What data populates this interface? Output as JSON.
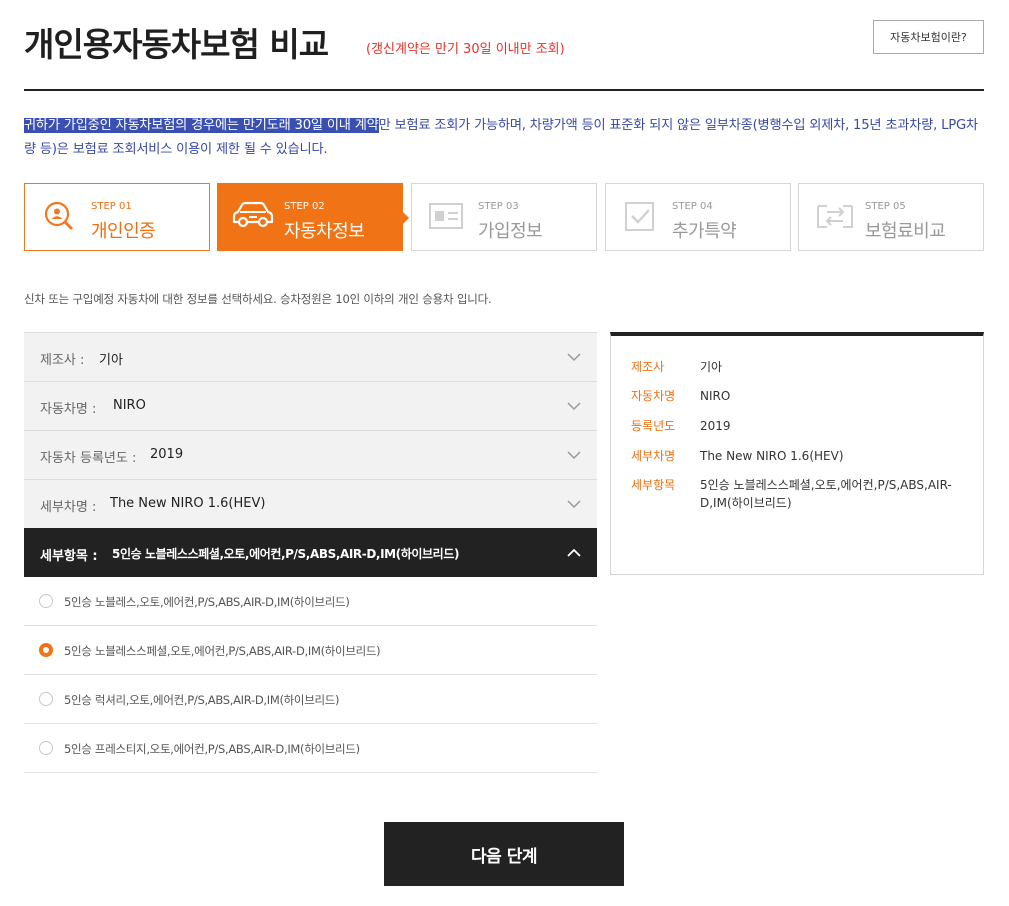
{
  "header": {
    "title": "개인용자동차보험 비교",
    "subtitle": "(갱신계약은 만기 30일 이내만 조회)",
    "help_button": "자동차보험이란?"
  },
  "notice": {
    "highlighted": "귀하가 가입중인 자동차보험의 경우에는 만기도래 30일 이내 계약",
    "rest": "만 보험료 조회가 가능하며, 차량가액 등이 표준화 되지 않은 일부차종(병행수입 외제차, 15년 초과차량, LPG차량 등)은 보험료 조회서비스 이용이 제한 될 수 있습니다."
  },
  "steps": [
    {
      "num": "STEP 01",
      "label": "개인인증",
      "icon": "person-search-icon",
      "state": "done"
    },
    {
      "num": "STEP 02",
      "label": "자동차정보",
      "icon": "car-icon",
      "state": "active"
    },
    {
      "num": "STEP 03",
      "label": "가입정보",
      "icon": "id-card-icon",
      "state": "todo"
    },
    {
      "num": "STEP 04",
      "label": "추가특약",
      "icon": "checkbox-icon",
      "state": "todo"
    },
    {
      "num": "STEP 05",
      "label": "보험료비교",
      "icon": "compare-icon",
      "state": "todo"
    }
  ],
  "guide": "신차 또는 구입예정 자동차에 대한 정보를 선택하세요. 승차정원은 10인 이하의 개인 승용차 입니다.",
  "accordion": [
    {
      "key": "제조사 : ",
      "value": "기아"
    },
    {
      "key": "자동차명 : ",
      "value": "NIRO"
    },
    {
      "key": "자동차 등록년도 : ",
      "value": "2019"
    },
    {
      "key": "세부차명 : ",
      "value": "The New NIRO 1.6(HEV)"
    },
    {
      "key": "세부항목 : ",
      "value": "5인승 노블레스스페셜,오토,에어컨,P/S,ABS,AIR-D,IM(하이브리드)"
    }
  ],
  "options": [
    {
      "label": "5인승 노블레스,오토,에어컨,P/S,ABS,AIR-D,IM(하이브리드)",
      "selected": false
    },
    {
      "label": "5인승 노블레스스페셜,오토,에어컨,P/S,ABS,AIR-D,IM(하이브리드)",
      "selected": true
    },
    {
      "label": "5인승 럭셔리,오토,에어컨,P/S,ABS,AIR-D,IM(하이브리드)",
      "selected": false
    },
    {
      "label": "5인승 프레스티지,오토,에어컨,P/S,ABS,AIR-D,IM(하이브리드)",
      "selected": false
    }
  ],
  "summary": [
    {
      "key": "제조사",
      "value": "기아"
    },
    {
      "key": "자동차명",
      "value": "NIRO"
    },
    {
      "key": "등록년도",
      "value": "2019"
    },
    {
      "key": "세부차명",
      "value": "The New NIRO 1.6(HEV)"
    },
    {
      "key": "세부항목",
      "value": "5인승 노블레스스페셜,오토,에어컨,P/S,ABS,AIR-D,IM(하이브리드)"
    }
  ],
  "next_button": "다음 단계",
  "colors": {
    "accent": "#f07315",
    "subtitle": "#e5332a",
    "notice": "#3949a8",
    "dark": "#222222"
  }
}
